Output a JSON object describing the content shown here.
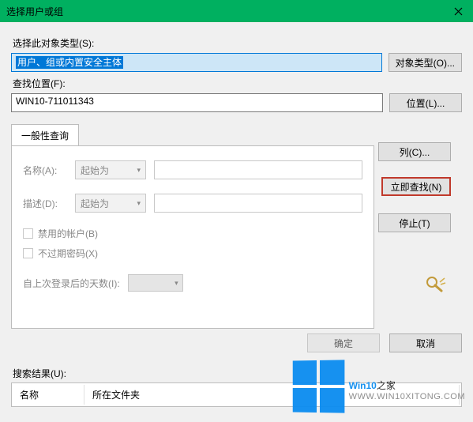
{
  "titlebar": {
    "title": "选择用户或组"
  },
  "sections": {
    "object_type_label": "选择此对象类型(S):",
    "object_type_value": "用户、组或内置安全主体",
    "object_type_btn": "对象类型(O)...",
    "location_label": "查找位置(F):",
    "location_value": "WIN10-711011343",
    "location_btn": "位置(L)..."
  },
  "tab": {
    "label": "一般性查询"
  },
  "query": {
    "name_label": "名称(A):",
    "name_combo": "起始为",
    "desc_label": "描述(D):",
    "desc_combo": "起始为",
    "disabled_accounts": "禁用的帐户(B)",
    "non_expiring": "不过期密码(X)",
    "days_since_logon": "自上次登录后的天数(I):"
  },
  "buttons": {
    "columns": "列(C)...",
    "find_now": "立即查找(N)",
    "stop": "停止(T)",
    "ok": "确定",
    "cancel": "取消"
  },
  "results": {
    "label": "搜索结果(U):",
    "col_name": "名称",
    "col_folder": "所在文件夹"
  },
  "watermark": {
    "line1_a": "Win10",
    "line1_b": "之家",
    "line2": "WWW.WIN10XITONG.COM"
  }
}
